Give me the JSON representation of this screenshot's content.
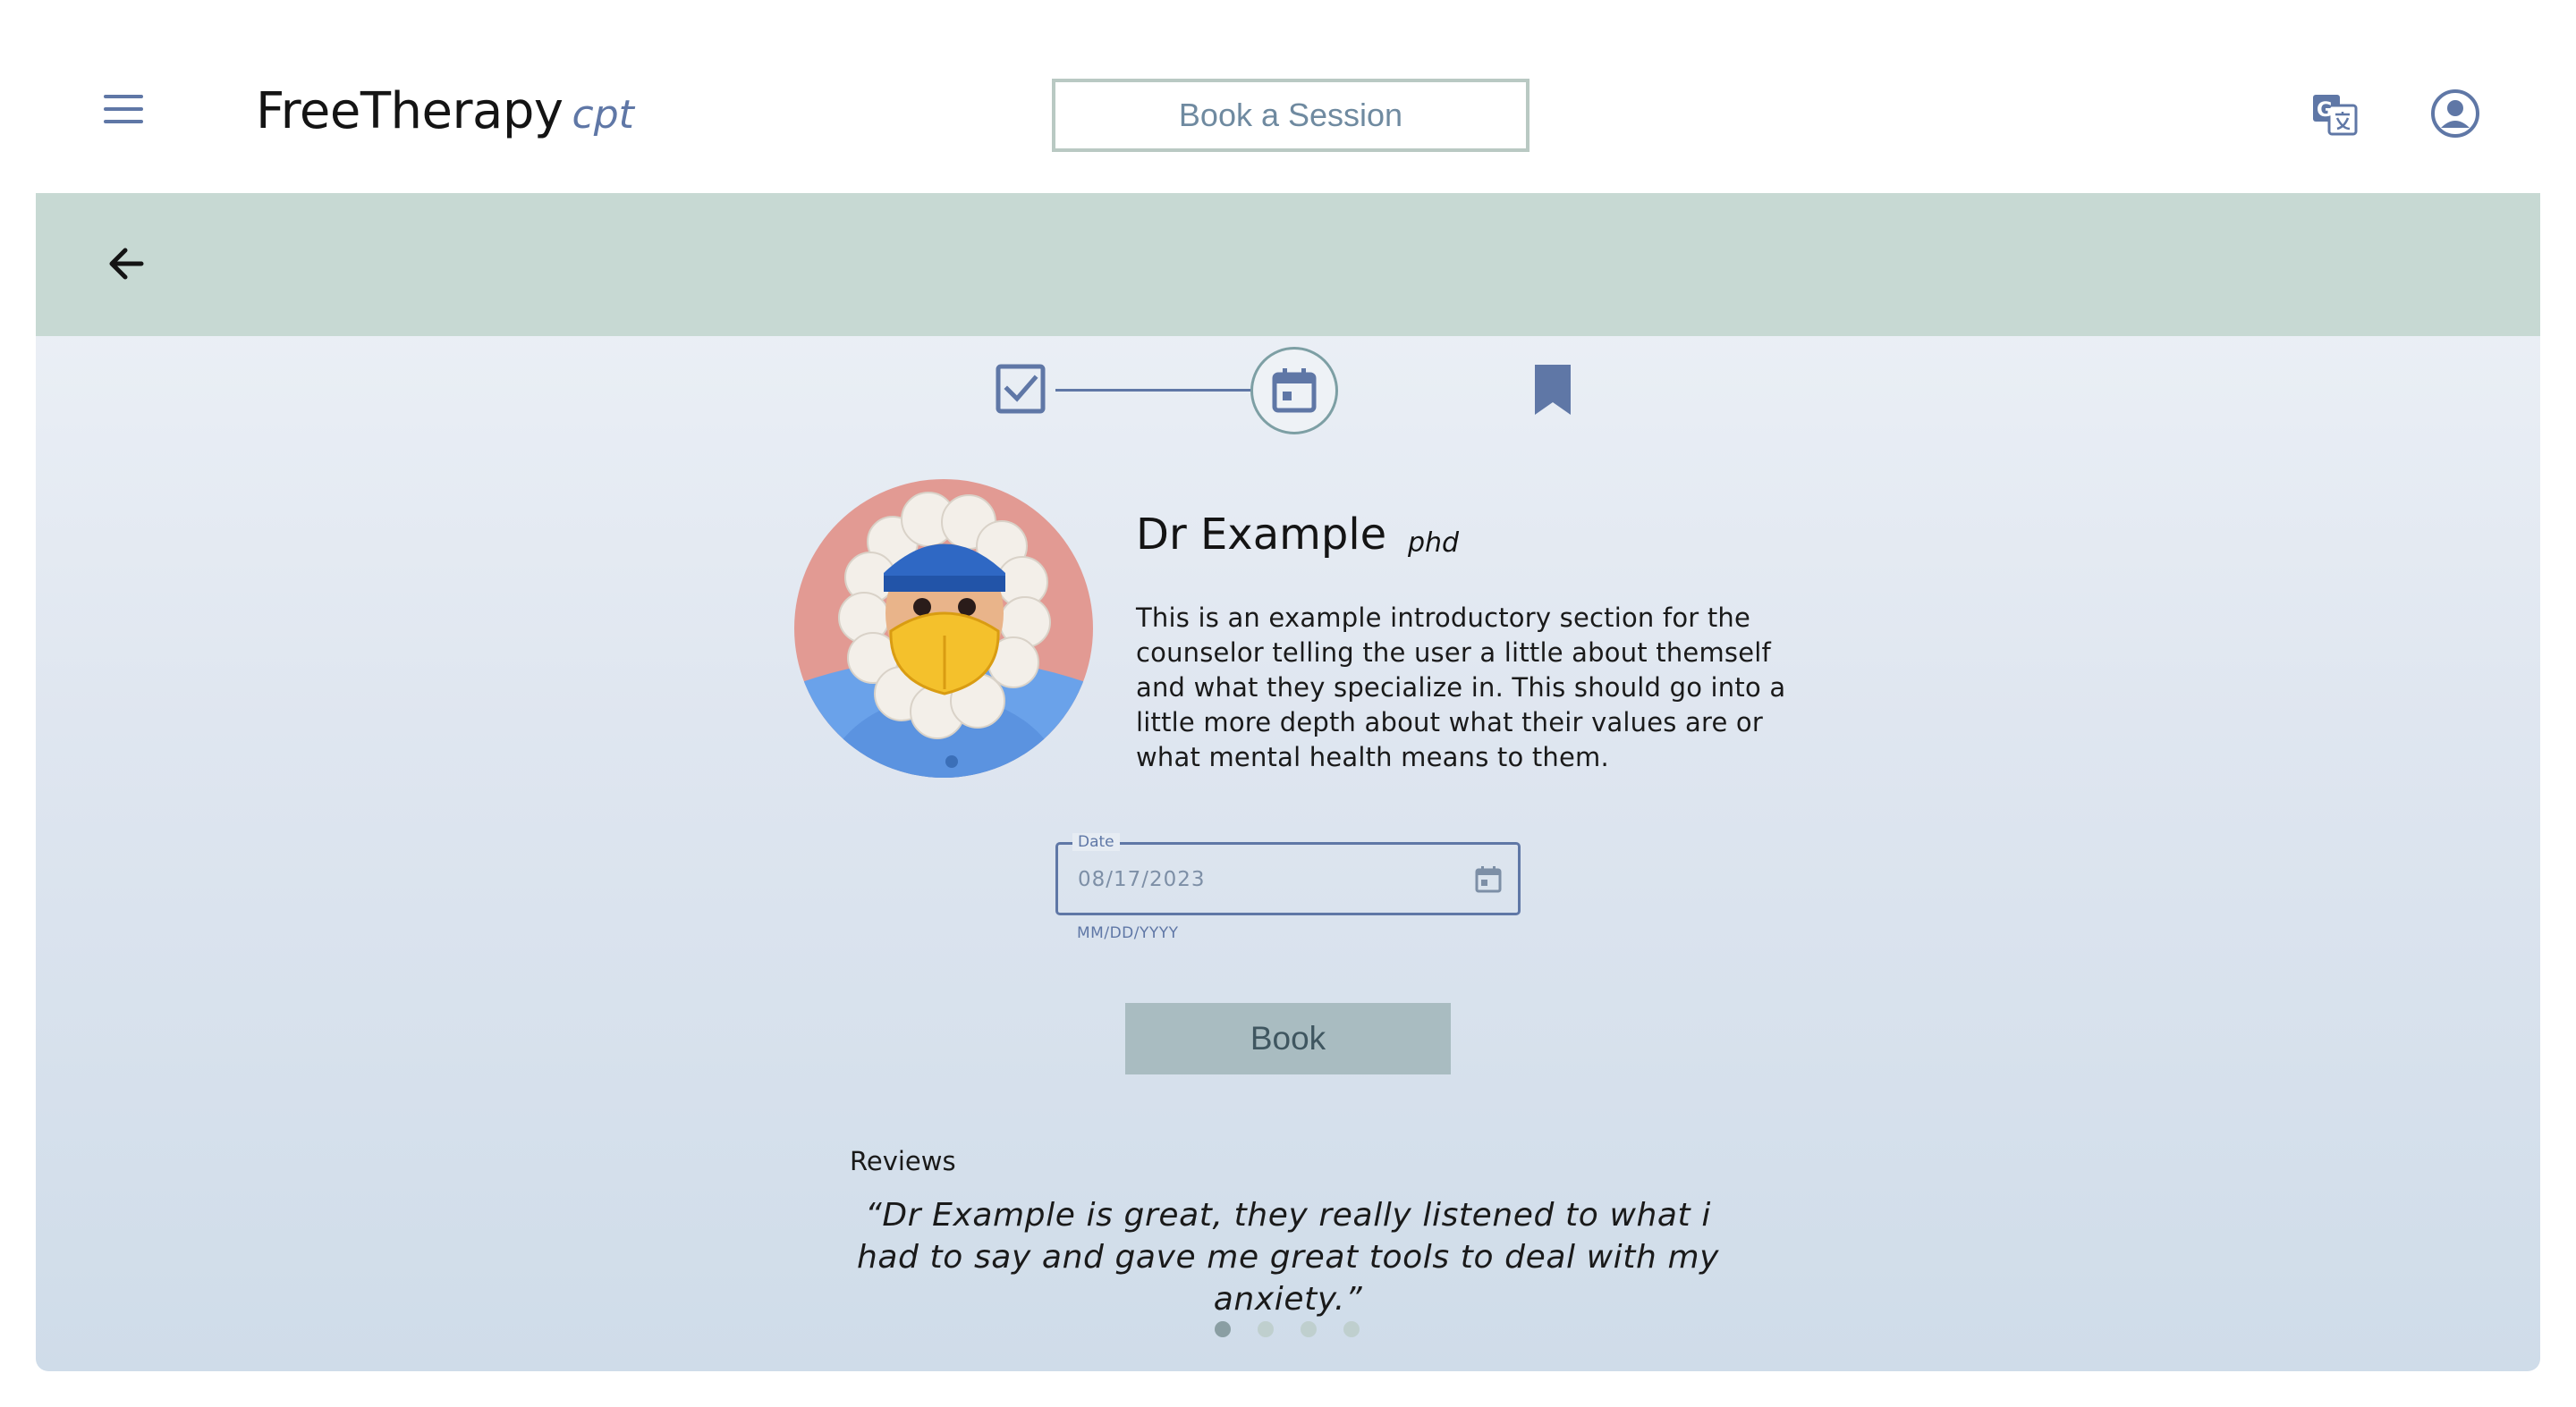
{
  "header": {
    "brand_main": "FreeTherapy",
    "brand_sub": "cpt",
    "book_session_label": "Book a Session",
    "menu_icon": "hamburger-menu-icon",
    "translate_icon": "google-translate-icon",
    "account_icon": "account-circle-icon"
  },
  "stepper": {
    "steps": [
      {
        "icon": "check-box-icon",
        "state": "completed"
      },
      {
        "icon": "calendar-icon",
        "state": "current"
      },
      {
        "icon": "bookmark-icon",
        "state": "pending"
      }
    ]
  },
  "counselor": {
    "name": "Dr Example",
    "degree": "phd",
    "bio": "This is an example introductory section for the counselor telling the user a little about themself and what they specialize in. This should go into a little more depth about what their values are or what mental health means to them."
  },
  "date_field": {
    "label": "Date",
    "value": "08/17/2023",
    "hint": "MM/DD/YYYY"
  },
  "book_label": "Book",
  "reviews": {
    "title": "Reviews",
    "items": [
      "“Dr Example is great, they really listened to what i had to say and gave me great tools to deal with my anxiety.”"
    ],
    "page_count": 4,
    "active_page": 1
  },
  "colors": {
    "accent": "#5f77a6",
    "banner": "#c7d9d3",
    "button": "#a9bcc1"
  }
}
